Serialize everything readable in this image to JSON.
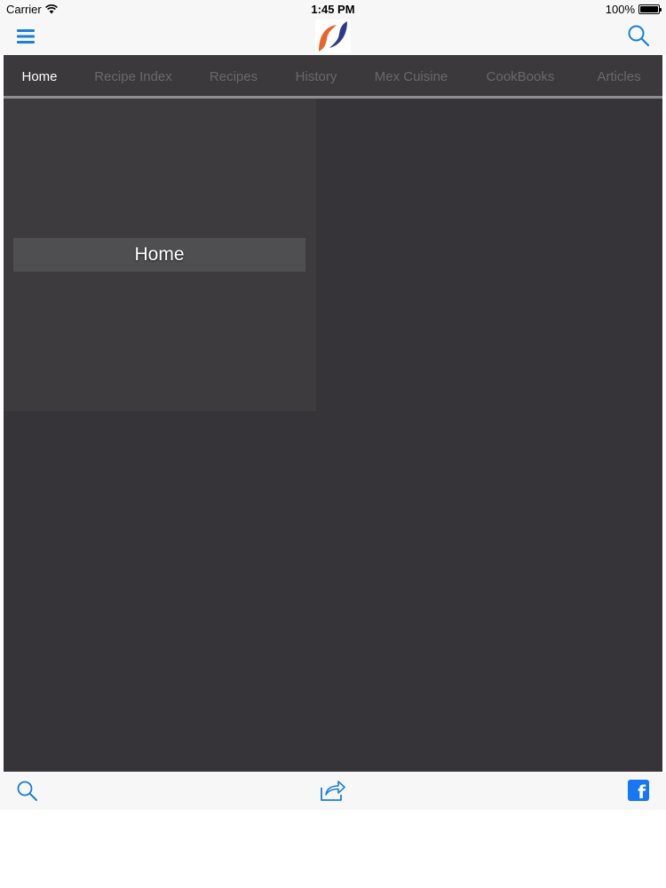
{
  "status_bar": {
    "carrier": "Carrier",
    "time": "1:45 PM",
    "battery": "100%",
    "battery_level": 1.0
  },
  "nav": {
    "menu_icon": "hamburger-menu-icon",
    "logo_icon": "app-logo",
    "search_icon": "search-icon",
    "accent_color": "#1a7fd9"
  },
  "tabs": [
    {
      "label": "Home",
      "active": true
    },
    {
      "label": "Recipe Index",
      "active": false
    },
    {
      "label": "Recipes",
      "active": false
    },
    {
      "label": "History",
      "active": false
    },
    {
      "label": "Mex Cuisine",
      "active": false
    },
    {
      "label": "CookBooks",
      "active": false
    },
    {
      "label": "Articles",
      "active": false
    }
  ],
  "tab_indicator_color": "#e8781e",
  "home_tile": {
    "label": "Home"
  },
  "toolbar": {
    "search_icon": "search-icon",
    "share_icon": "share-icon",
    "facebook_icon": "facebook-icon",
    "facebook_glyph": "f"
  }
}
